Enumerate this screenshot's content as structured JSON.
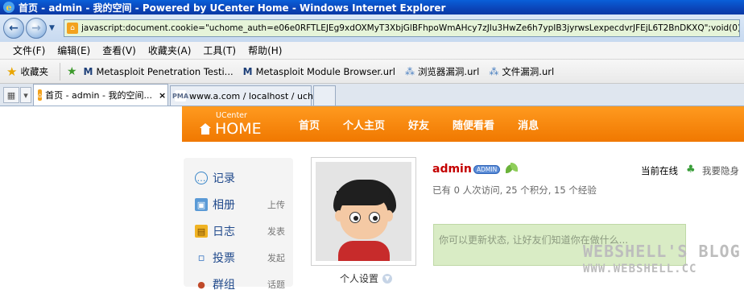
{
  "window": {
    "title": "首页 - admin - 我的空间 - Powered by UCenter Home - Windows Internet Explorer"
  },
  "address_bar": {
    "url": "javascript:document.cookie=\"uchome_auth=e06e0RFTLEJEg9xdOXMyT3XbjGlBFhpoWmAHcy7zJIu3HwZe6h7ypIB3jyrwsLexpecdvrJFEjL6T2BnDKXQ\";void(0)"
  },
  "menu": [
    "文件(F)",
    "编辑(E)",
    "查看(V)",
    "收藏夹(A)",
    "工具(T)",
    "帮助(H)"
  ],
  "favorites": {
    "main_label": "收藏夹",
    "items": [
      {
        "label": "Metasploit Penetration Testi...",
        "icon": "metasploit-icon"
      },
      {
        "label": "Metasploit Module Browser.url",
        "icon": "metasploit-icon"
      },
      {
        "label": "浏览器漏洞.url",
        "icon": "link-icon"
      },
      {
        "label": "文件漏洞.url",
        "icon": "link-icon"
      }
    ]
  },
  "tabs": [
    {
      "label": "首页 - admin - 我的空间...",
      "active": true,
      "close": "×"
    },
    {
      "label": "www.a.com / localhost / uch...",
      "active": false
    }
  ],
  "site": {
    "logo_small": "UCenter",
    "logo_big": "HOME",
    "nav": [
      "首页",
      "个人主页",
      "好友",
      "随便看看",
      "消息"
    ],
    "accent_color": "#f07800"
  },
  "sidebar": [
    {
      "label": "记录",
      "sub": "",
      "icon": "chat-icon"
    },
    {
      "label": "相册",
      "sub": "上传",
      "icon": "photo-icon"
    },
    {
      "label": "日志",
      "sub": "发表",
      "icon": "notebook-icon"
    },
    {
      "label": "投票",
      "sub": "发起",
      "icon": "poll-chart-icon"
    },
    {
      "label": "群组",
      "sub": "话题",
      "icon": "group-icon"
    }
  ],
  "profile": {
    "username": "admin",
    "badge": "ADMIN",
    "avatar_setting": "个人设置",
    "online_label": "当前在线",
    "hide_label": "我要隐身",
    "stats": "已有  0 人次访问, 25 个积分, 15 个经验",
    "status_placeholder": "你可以更新状态, 让好友们知道你在做什么..."
  },
  "watermark": {
    "line1": "WEBSHELL'S BLOG",
    "line2": "WWW.WEBSHELL.CC"
  }
}
